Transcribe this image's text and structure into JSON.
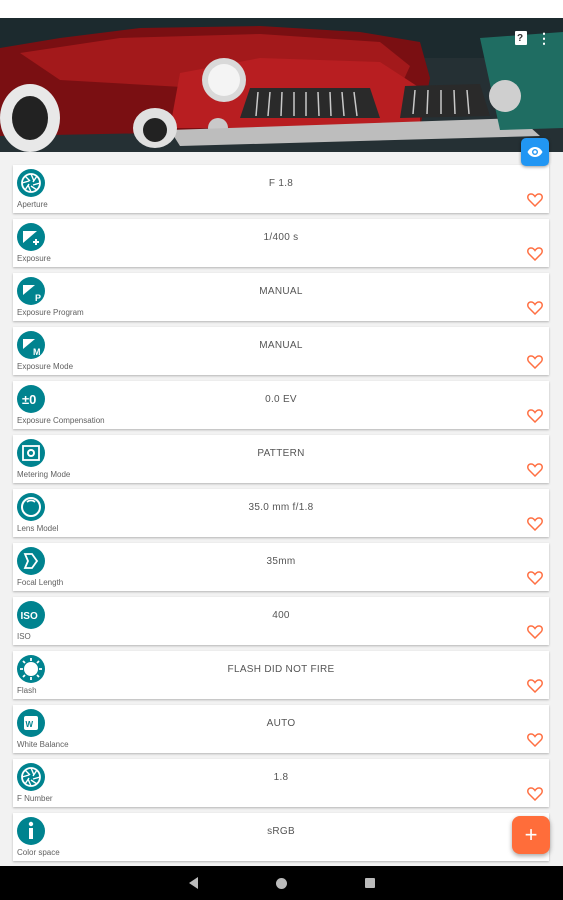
{
  "colors": {
    "icon_teal": "#00838f",
    "heart": "#ff7043",
    "eye_fab": "#2196f3",
    "add_fab": "#ff6d3a"
  },
  "toolbar": {
    "help_icon": "help-document-icon",
    "more_icon": "more-vert-icon"
  },
  "rows": [
    {
      "label": "Aperture",
      "value": "F 1.8",
      "icon": "aperture-icon"
    },
    {
      "label": "Exposure",
      "value": "1/400 s",
      "icon": "exposure-icon"
    },
    {
      "label": "Exposure Program",
      "value": "MANUAL",
      "icon": "exposure-program-icon"
    },
    {
      "label": "Exposure Mode",
      "value": "MANUAL",
      "icon": "exposure-mode-icon"
    },
    {
      "label": "Exposure Compensation",
      "value": "0.0 EV",
      "icon": "exposure-compensation-icon"
    },
    {
      "label": "Metering Mode",
      "value": "PATTERN",
      "icon": "metering-mode-icon"
    },
    {
      "label": "Lens Model",
      "value": "35.0 mm f/1.8",
      "icon": "lens-icon"
    },
    {
      "label": "Focal Length",
      "value": "35mm",
      "icon": "focal-length-icon"
    },
    {
      "label": "ISO",
      "value": "400",
      "icon": "iso-icon"
    },
    {
      "label": "Flash",
      "value": "FLASH DID NOT FIRE",
      "icon": "flash-icon"
    },
    {
      "label": "White Balance",
      "value": "AUTO",
      "icon": "white-balance-icon"
    },
    {
      "label": "F Number",
      "value": "1.8",
      "icon": "aperture-icon"
    },
    {
      "label": "Color space",
      "value": "sRGB",
      "icon": "info-icon"
    }
  ],
  "fab": {
    "add_label": "+"
  }
}
